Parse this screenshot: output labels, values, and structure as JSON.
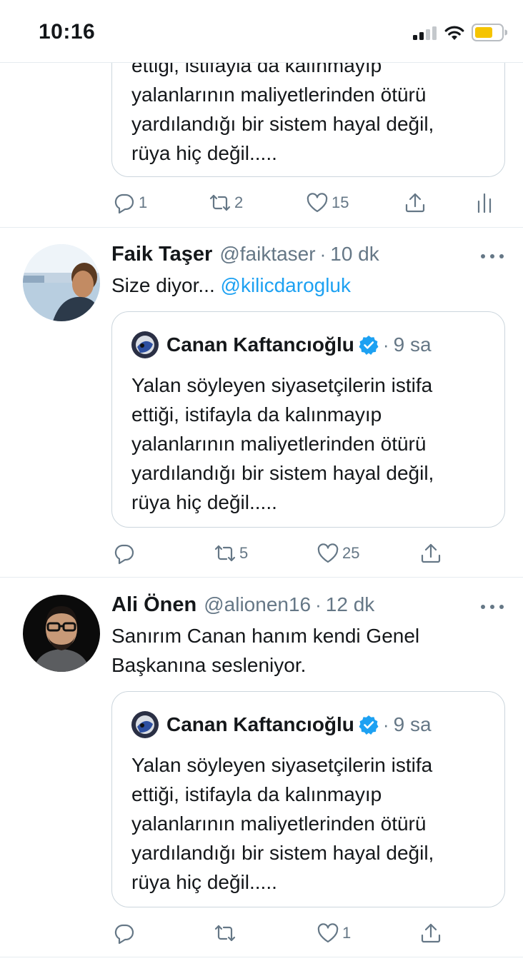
{
  "status_bar": {
    "time": "10:16"
  },
  "top_tweet": {
    "quote_tail": [
      "ettiği, istifayla da kalınmayıp",
      "yalanlarının maliyetlerinden ötürü",
      "yardılandığı bir sistem hayal değil,",
      "rüya hiç değil....."
    ],
    "actions": {
      "reply_count": "1",
      "retweet_count": "2",
      "like_count": "15"
    }
  },
  "tweets": [
    {
      "name": "Faik Taşer",
      "handle": "@faiktaser",
      "time": "10 dk",
      "text_prefix": "Size diyor... ",
      "mention": "@kilicdarogluk",
      "quote": {
        "name": "Canan Kaftancıoğlu",
        "time": "9 sa",
        "lines": [
          "Yalan söyleyen siyasetçilerin istifa",
          "ettiği, istifayla da kalınmayıp",
          "yalanlarının maliyetlerinden ötürü",
          "yardılandığı bir sistem hayal değil,",
          "rüya hiç değil....."
        ]
      },
      "actions": {
        "reply_count": "",
        "retweet_count": "5",
        "like_count": "25"
      }
    },
    {
      "name": "Ali Önen",
      "handle": "@alionen16",
      "time": "12 dk",
      "text_lines": [
        "Sanırım Canan hanım kendi Genel",
        "Başkanına sesleniyor."
      ],
      "quote": {
        "name": "Canan Kaftancıoğlu",
        "time": "9 sa",
        "lines": [
          "Yalan söyleyen siyasetçilerin istifa",
          "ettiği, istifayla da kalınmayıp",
          "yalanlarının maliyetlerinden ötürü",
          "yardılandığı bir sistem hayal değil,",
          "rüya hiç değil....."
        ]
      },
      "actions": {
        "reply_count": "",
        "retweet_count": "",
        "like_count": "1"
      }
    }
  ],
  "colors": {
    "accent": "#1da1f2",
    "text": "#14171a",
    "muted": "#657786",
    "border": "#e6ecf0",
    "battery": "#f5c400"
  },
  "icons": [
    "reply-icon",
    "retweet-icon",
    "like-icon",
    "share-icon",
    "analytics-icon",
    "more-icon",
    "verified-icon"
  ]
}
